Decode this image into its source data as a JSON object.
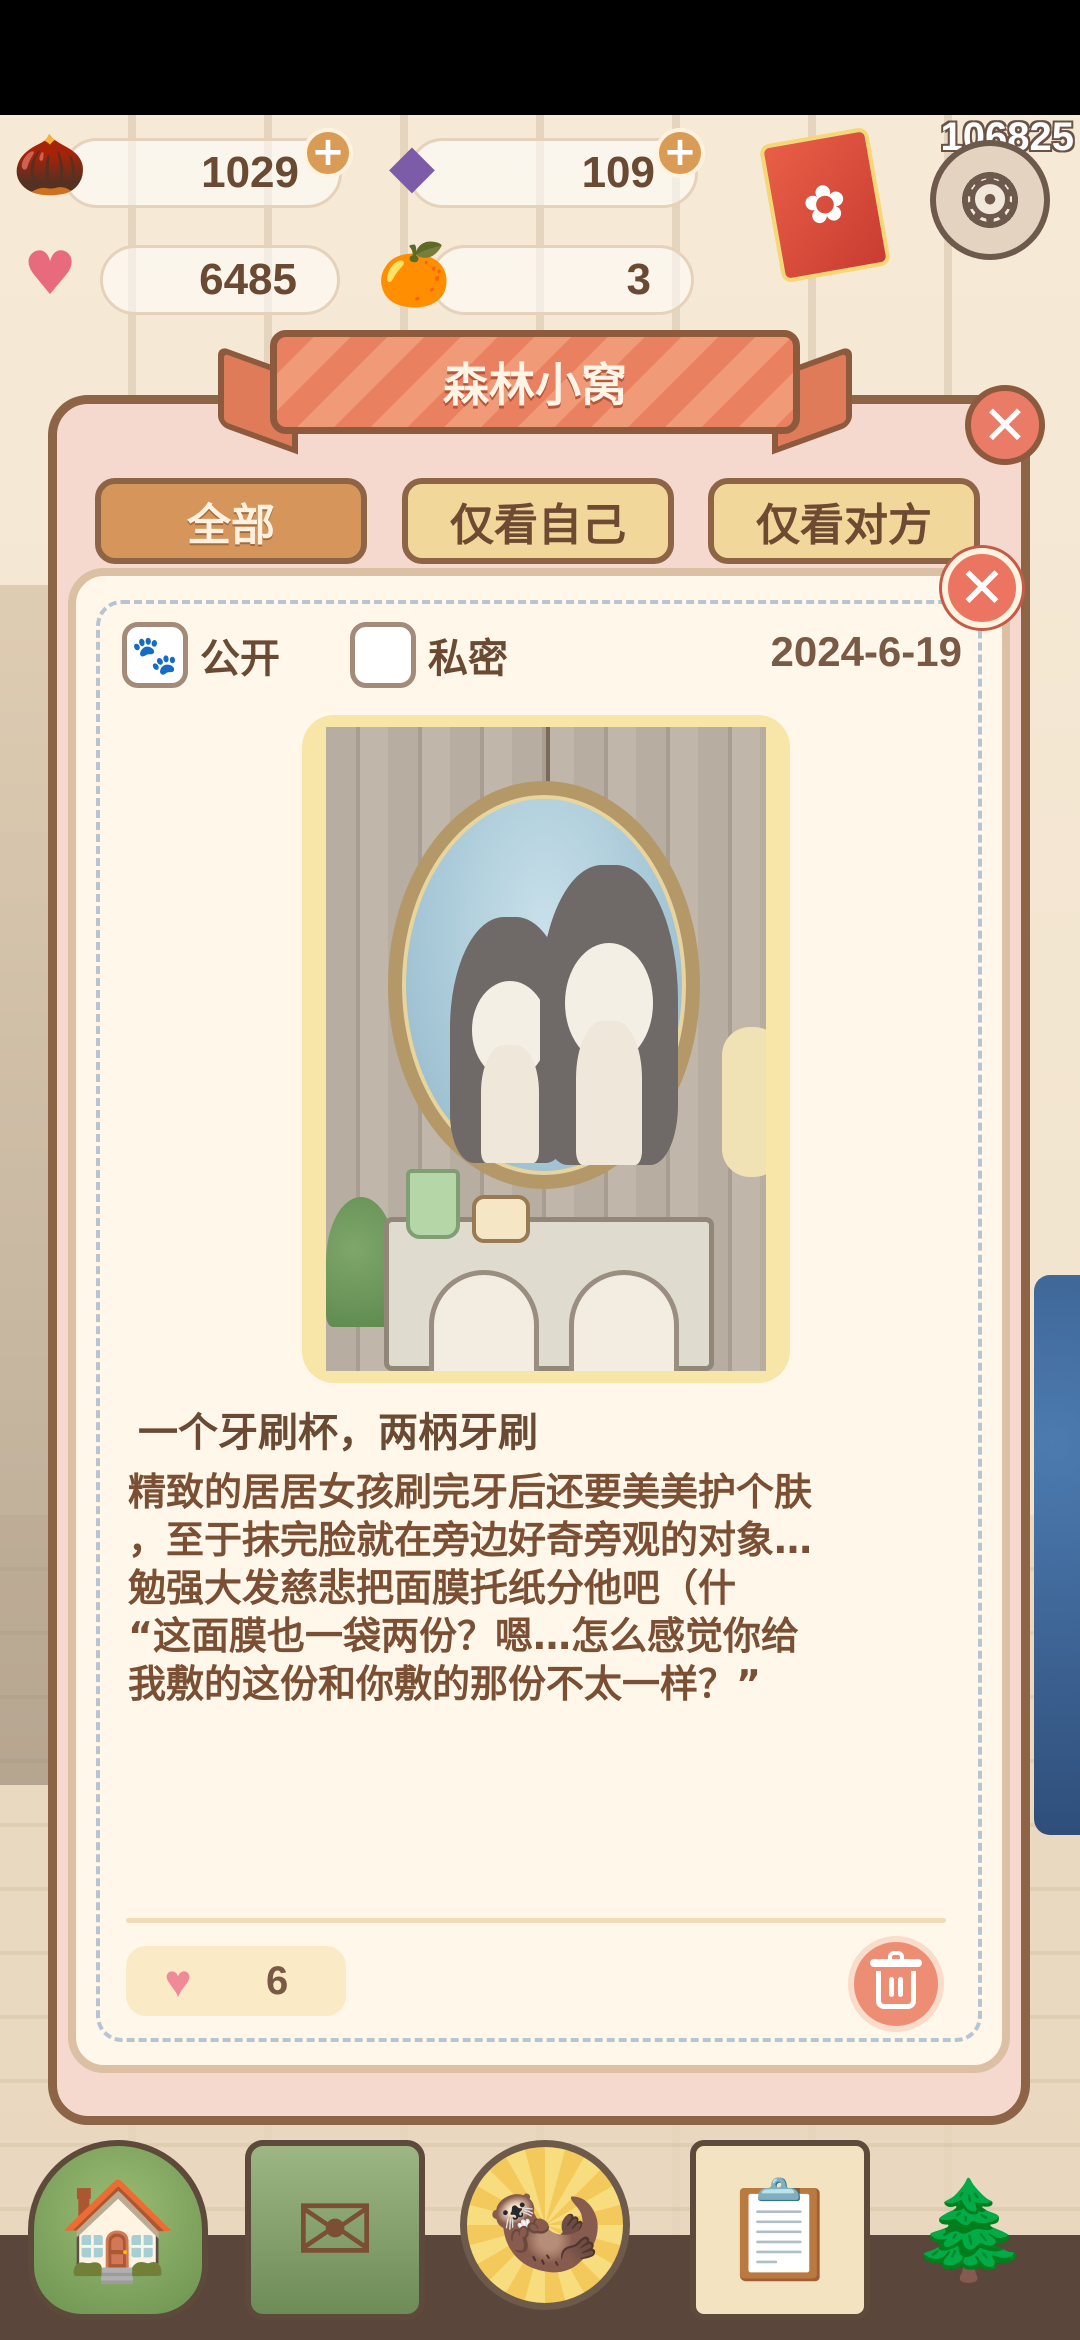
{
  "resources": {
    "acorn": {
      "icon": "acorn-icon",
      "value": "1029"
    },
    "gem": {
      "icon": "purple-gem-icon",
      "value": "109"
    },
    "heart_gem": {
      "icon": "heart-gem-icon",
      "value": "6485"
    },
    "orange": {
      "icon": "orange-icon",
      "value": "3"
    }
  },
  "player_id": "106825",
  "panel": {
    "title": "森林小窝",
    "tabs": [
      {
        "label": "全部",
        "active": true
      },
      {
        "label": "仅看自己",
        "active": false
      },
      {
        "label": "仅看对方",
        "active": false
      }
    ]
  },
  "entry": {
    "visibility": {
      "public_label": "公开",
      "private_label": "私密",
      "selected": "public"
    },
    "date": "2024-6-19",
    "title": "一个牙刷杯，两柄牙刷",
    "body_lines": [
      "精致的居居女孩刷完牙后还要美美护个肤",
      "，至于抹完脸就在旁边好奇旁观的对象…",
      "勉强大发慈悲把面膜托纸分他吧（什",
      "“这面膜也一袋两份？嗯…怎么感觉你给",
      "我敷的这份和你敷的那份不太一样？”"
    ],
    "likes": "6"
  },
  "colors": {
    "accent_orange": "#e9805f",
    "panel_border": "#8e6446",
    "close_red": "#ec7562",
    "delete_bg": "#ec8d74"
  },
  "nav": [
    "home-icon",
    "mail-icon",
    "otter-center-icon",
    "clipboard-task-icon",
    "map-icon"
  ]
}
